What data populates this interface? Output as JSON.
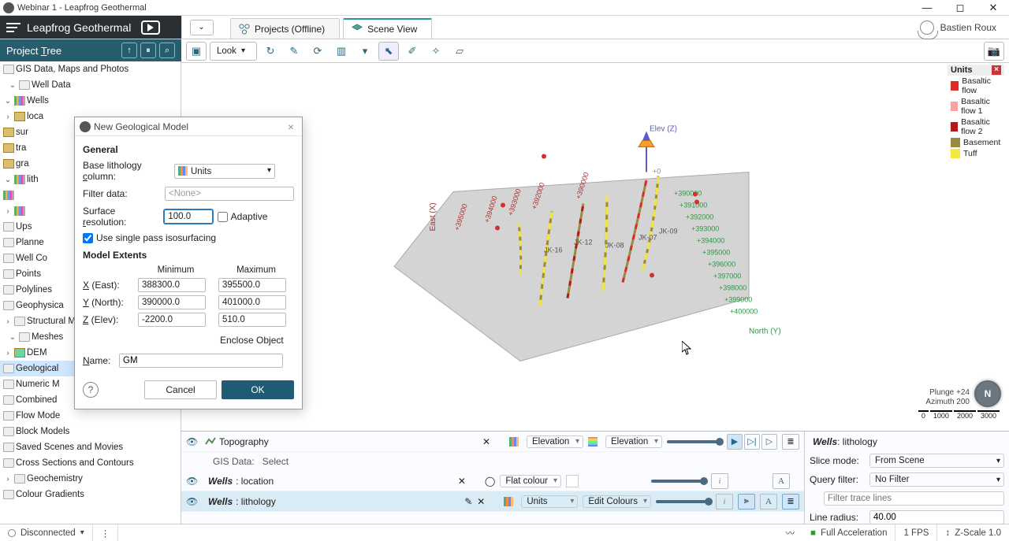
{
  "window_title": "Webinar 1 - Leapfrog Geothermal",
  "brand": "Leapfrog Geothermal",
  "tabs": [
    {
      "label": "Projects (Offline)"
    },
    {
      "label": "Scene View"
    }
  ],
  "user_name": "Bastien Roux",
  "project_tree_label": "Project Tree",
  "tree": {
    "gis": "GIS Data, Maps and Photos",
    "well_data": "Well Data",
    "wells": "Wells",
    "loca": "loca",
    "sur": "sur",
    "tra": "tra",
    "gra": "gra",
    "lith": "lith",
    "ups": "Ups",
    "planned": "Planne",
    "wellcor": "Well Co",
    "points": "Points",
    "polylines": "Polylines",
    "geophysica": "Geophysica",
    "structural": "Structural M",
    "meshes": "Meshes",
    "dem": "DEM",
    "geological": "Geological",
    "numeric": "Numeric M",
    "combined": "Combined",
    "flowmod": "Flow Mode",
    "blockmod": "Block Models",
    "saved": "Saved Scenes and Movies",
    "cross": "Cross Sections and Contours",
    "geochem": "Geochemistry",
    "colgrad": "Colour Gradients"
  },
  "toolbar": {
    "look": "Look"
  },
  "legend": {
    "title": "Units",
    "items": [
      {
        "label": "Basaltic flow",
        "color": "#e02a2a"
      },
      {
        "label": "Basaltic flow 1",
        "color": "#f5a3a3"
      },
      {
        "label": "Basaltic flow 2",
        "color": "#b51818"
      },
      {
        "label": "Basement",
        "color": "#9a8a3f"
      },
      {
        "label": "Tuff",
        "color": "#f5e640"
      }
    ]
  },
  "axis": {
    "elev": "Elev (Z)",
    "east": "East (X)",
    "north": "North (Y)"
  },
  "compass": {
    "plunge": "Plunge  +24",
    "azimuth": "Azimuth 200",
    "scale": [
      "0",
      "1000",
      "2000",
      "3000"
    ]
  },
  "scene": {
    "rows": [
      {
        "name_b": "",
        "name_i": "Topography",
        "mode": "Elevation",
        "mode2": "Elevation"
      },
      {
        "name_b": "Wells",
        "name_i": ": location",
        "mode": "Flat colour"
      },
      {
        "name_b": "Wells",
        "name_i": ": lithology",
        "mode": "Units",
        "edit": "Edit Colours"
      }
    ],
    "gis_label": "GIS Data:",
    "gis_select": "Select"
  },
  "props": {
    "title_b": "Wells",
    "title_i": ": lithology",
    "slice_label": "Slice mode:",
    "slice_val": "From Scene",
    "query_label": "Query filter:",
    "query_val": "No Filter",
    "filter_placeholder": "Filter trace lines",
    "radius_label": "Line radius:",
    "radius_val": "40.00"
  },
  "status": {
    "conn": "Disconnected",
    "fullacc": "Full Acceleration",
    "fps": "1 FPS",
    "zscale": "Z-Scale 1.0"
  },
  "dialog": {
    "title": "New Geological Model",
    "general": "General",
    "base_lith_label": "Base lithology column:",
    "base_lith_val": "Units",
    "filter_label": "Filter data:",
    "filter_placeholder": "<None>",
    "surfres_label": "Surface resolution:",
    "surfres_val": "100.0",
    "adaptive": "Adaptive",
    "singlepass": "Use single pass isosurfacing",
    "extents": "Model Extents",
    "min": "Minimum",
    "max": "Maximum",
    "xlabel": "X (East):",
    "ylabel": "Y (North):",
    "zlabel": "Z (Elev):",
    "xmin": "388300.0",
    "xmax": "395500.0",
    "ymin": "390000.0",
    "ymax": "401000.0",
    "zmin": "-2200.0",
    "zmax": "510.0",
    "enclose": "Enclose Object",
    "name_label": "Name:",
    "name_val": "GM",
    "cancel": "Cancel",
    "ok": "OK"
  }
}
